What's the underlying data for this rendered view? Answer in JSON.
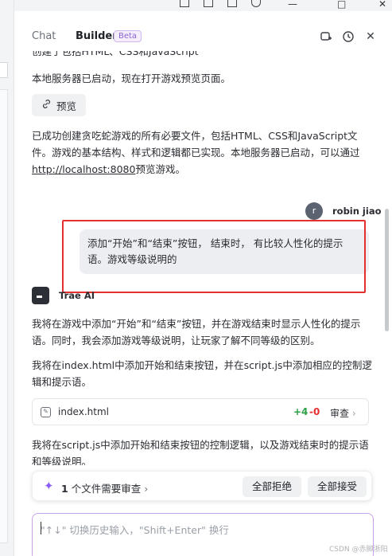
{
  "header": {
    "tab_chat": "Chat",
    "tab_builder": "Builder",
    "beta": "Beta"
  },
  "messages": {
    "cut_line": "创建了包括HTML、CSS和JavaScript",
    "server_started": "本地服务器已启动，现在打开游戏预览页面。",
    "preview_label": "预览",
    "summary_part1": "已成功创建贪吃蛇游戏的所有必要文件，包括HTML、CSS和JavaScript文件。游戏的基本结构、样式和逻辑都已实现。本地服务器已启动，可以通过",
    "summary_link": "http://localhost:8080",
    "summary_part2": "预览游戏。",
    "user_avatar": "r",
    "user_name": "robin jiao",
    "user_message": "添加“开始”和“结束”按钮， 结束时， 有比较人性化的提示语。游戏等级说明的",
    "ai_name": "Trae AI",
    "ai_msg1": "我将在游戏中添加“开始”和“结束”按钮，并在游戏结束时显示人性化的提示语。同时，我会添加游戏等级说明，让玩家了解不同等级的区别。",
    "ai_msg2": "我将在index.html中添加开始和结束按钮，并在script.js中添加相应的控制逻辑和提示语。",
    "ai_msg3": "我将在script.js中添加开始和结束按钮的控制逻辑，以及游戏结束时的提示语和等级说明。"
  },
  "file_card": {
    "file_name": "index.html",
    "added": "+4",
    "removed": "-0",
    "review": "审查"
  },
  "review_bar": {
    "count": "1",
    "text": "个文件需要审查",
    "reject_all": "全部拒绝",
    "accept_all": "全部接受"
  },
  "input": {
    "placeholder": "\"↑↓\" 切换历史输入，\"Shift+Enter\" 换行"
  },
  "watermark": "CSDN @赤脚浙阳",
  "colors": {
    "accent_purple": "#8b5cf6",
    "highlight_red": "#e5302f",
    "diff_add": "#2ea043",
    "diff_del": "#e5302f"
  }
}
